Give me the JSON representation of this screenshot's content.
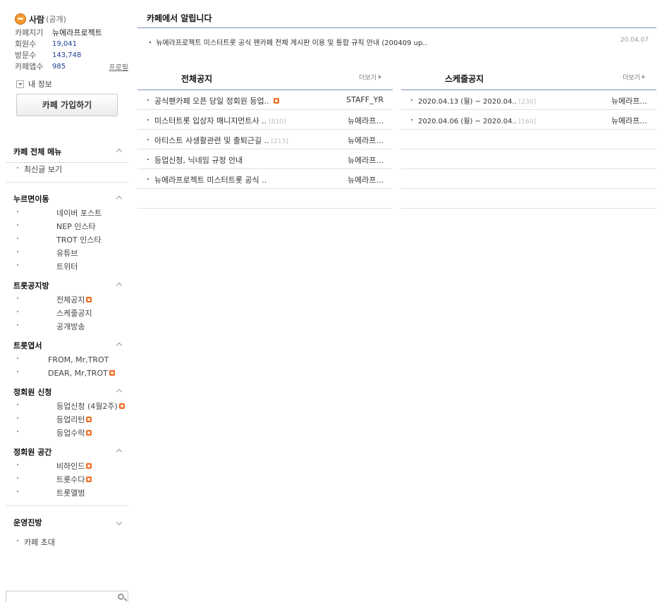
{
  "cafe": {
    "level_name": "사람",
    "level_paren": "(공개)",
    "rows": [
      {
        "label": "카페지기",
        "value": "뉴에라프로젝트",
        "dark": true,
        "link": ""
      },
      {
        "label": "회원수",
        "value": "19,041",
        "dark": false,
        "link": ""
      },
      {
        "label": "방문수",
        "value": "143,748",
        "dark": false,
        "link": ""
      },
      {
        "label": "카페앱수",
        "value": "985",
        "dark": false,
        "link": "프로필"
      }
    ],
    "my_info": "내 정보",
    "join_button": "카페 가입하기"
  },
  "menu": {
    "sections": [
      {
        "title": "카페 전체 메뉴",
        "open": true,
        "indent": 26,
        "items": [
          {
            "label": "최신글 보기",
            "new": false
          }
        ]
      },
      {
        "title": "누르면이동",
        "open": true,
        "indent": 72,
        "items": [
          {
            "label": "네이버 포스트",
            "new": false
          },
          {
            "label": "NEP 인스타",
            "new": false
          },
          {
            "label": "TROT 인스타",
            "new": false
          },
          {
            "label": "유튜브",
            "new": false
          },
          {
            "label": "트위터",
            "new": false
          }
        ]
      },
      {
        "title": "트롯공지방",
        "open": true,
        "indent": 72,
        "items": [
          {
            "label": "전체공지",
            "new": true
          },
          {
            "label": "스케줄공지",
            "new": false
          },
          {
            "label": "공개방송",
            "new": false
          }
        ]
      },
      {
        "title": "트롯엽서",
        "open": true,
        "indent": 60,
        "items": [
          {
            "label": "FROM, Mr,TROT",
            "new": false
          },
          {
            "label": "DEAR, Mr,TROT",
            "new": true
          }
        ]
      },
      {
        "title": "정회원 신청",
        "open": true,
        "indent": 72,
        "items": [
          {
            "label": "등업신청 (4월2주)",
            "new": true,
            "wrap": true
          },
          {
            "label": "등업리턴",
            "new": true
          },
          {
            "label": "등업수락",
            "new": true
          }
        ]
      },
      {
        "title": "정회원 공간",
        "open": true,
        "indent": 72,
        "items": [
          {
            "label": "비하인드",
            "new": true
          },
          {
            "label": "트롯수다",
            "new": true
          },
          {
            "label": "트롯앨범",
            "new": false
          }
        ]
      },
      {
        "title": "운영진방",
        "open": false,
        "indent": 26,
        "items": [
          {
            "label": "카페 초대",
            "new": false
          }
        ]
      }
    ]
  },
  "notice": {
    "title": "카페에서 알립니다",
    "text": "뉴에라프로젝트 미스터트롯 공식 팬카페 전체 게시판 이용 및 통합 규칙 안내 (200409 up..",
    "date": "20.04.07"
  },
  "boards": {
    "all": {
      "title": "전체공지",
      "more": "더보기",
      "rows": [
        {
          "title": "공식팬카페 오픈 당일 정회원 등업..",
          "count": "",
          "new": true,
          "writer": "STAFF_YR"
        },
        {
          "title": "미스터트롯 입상자 매니지먼트사 ..",
          "count": "[810]",
          "new": false,
          "writer": "뉴에라프..."
        },
        {
          "title": "아티스트 사생활관련 및 출퇴근길 ..",
          "count": "[213]",
          "new": false,
          "writer": "뉴에라프..."
        },
        {
          "title": "등업신청, 닉네임 규정 안내",
          "count": "",
          "new": false,
          "writer": "뉴에라프..."
        },
        {
          "title": "뉴에라프로젝트 미스터트롯 공식 ..",
          "count": "",
          "new": false,
          "writer": "뉴에라프..."
        }
      ]
    },
    "schedule": {
      "title": "스케줄공지",
      "more": "더보기",
      "rows": [
        {
          "title": "2020.04.13 (월) ~ 2020.04..",
          "count": "[230]",
          "new": false,
          "writer": "뉴에라프..."
        },
        {
          "title": "2020.04.06 (월) ~ 2020.04..",
          "count": "[160]",
          "new": false,
          "writer": "뉴에라프..."
        }
      ]
    }
  },
  "icons": {
    "avatar": "level-avatar-icon",
    "search": "search-icon",
    "new": "new-badge-icon"
  },
  "colors": {
    "header_line": "#7d8fb3",
    "value_blue": "#1c3f94",
    "new_badge": "#f26a21"
  }
}
